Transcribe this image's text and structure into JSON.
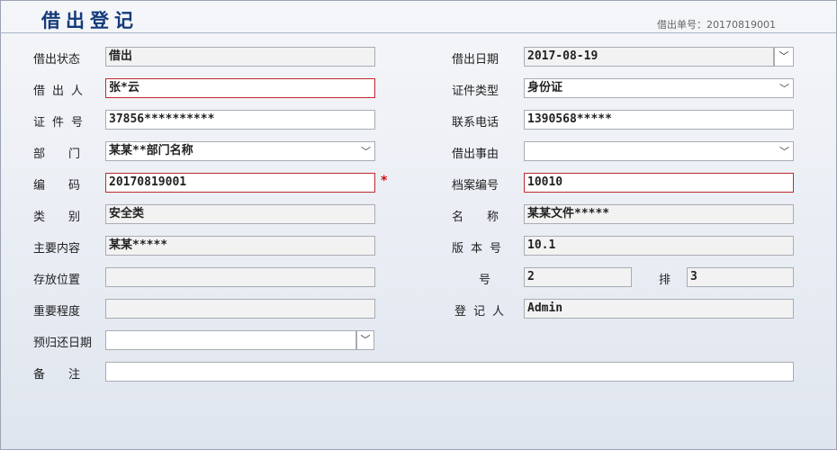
{
  "header": {
    "title": "借出登记",
    "doc_no": "借出单号：20170819001"
  },
  "left": {
    "status_label": "借出状态",
    "status_value": "借出",
    "borrower_label": "借出人",
    "borrower_value": "张*云",
    "id_label": "证件号",
    "id_value": "37856**********",
    "dept_label": "部门",
    "dept_value": "某某**部门名称",
    "code_label": "编码",
    "code_value": "20170819001",
    "code_required": "*",
    "category_label": "类别",
    "category_value": "安全类",
    "content_label": "主要内容",
    "content_value": "某某*****",
    "location_label": "存放位置",
    "location_value": "",
    "importance_label": "重要程度",
    "importance_value": "",
    "return_label": "预归还日期",
    "return_value": "",
    "remark_label": "备注",
    "remark_value": ""
  },
  "right": {
    "date_label": "借出日期",
    "date_value": "2017-08-19",
    "idtype_label": "证件类型",
    "idtype_value": "身份证",
    "phone_label": "联系电话",
    "phone_value": "1390568*****",
    "reason_label": "借出事由",
    "reason_value": "",
    "archive_label": "档案编号",
    "archive_value": "10010",
    "name_label": "名称",
    "name_value": "某某文件*****",
    "version_label": "版本号",
    "version_value": "10.1",
    "number_label": "号",
    "number_value": "2",
    "row_label": "排",
    "row_value": "3",
    "registrar_label": "登记人",
    "registrar_value": "Admin"
  }
}
